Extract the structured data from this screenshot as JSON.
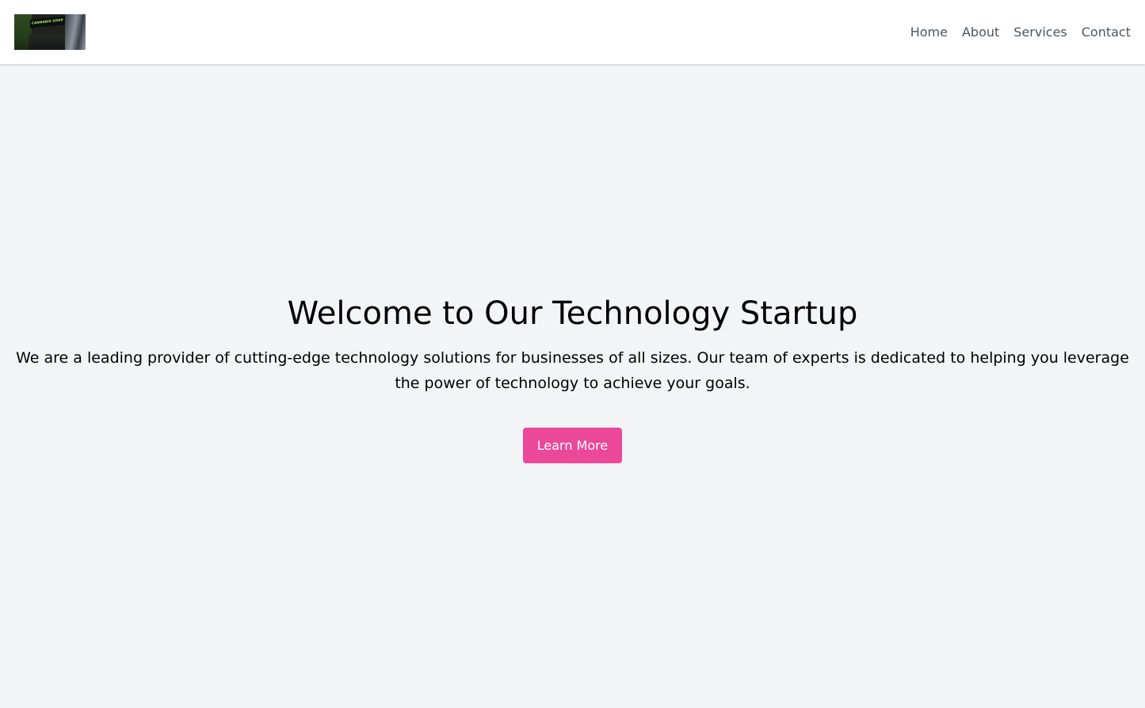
{
  "header": {
    "logo": {
      "icon": "storefront-logo-image",
      "sign_text": "CANNABIS SHOP"
    },
    "nav": [
      {
        "label": "Home"
      },
      {
        "label": "About"
      },
      {
        "label": "Services"
      },
      {
        "label": "Contact"
      }
    ]
  },
  "hero": {
    "title": "Welcome to Our Technology Startup",
    "description": "We are a leading provider of cutting-edge technology solutions for businesses of all sizes. Our team of experts is dedicated to helping you leverage the power of technology to achieve your goals.",
    "cta_label": "Learn More"
  },
  "colors": {
    "page_background": "#f3f4f6",
    "header_background": "#ffffff",
    "nav_text": "#4b5563",
    "accent": "#ec4899",
    "cta_text": "#ffffff"
  }
}
